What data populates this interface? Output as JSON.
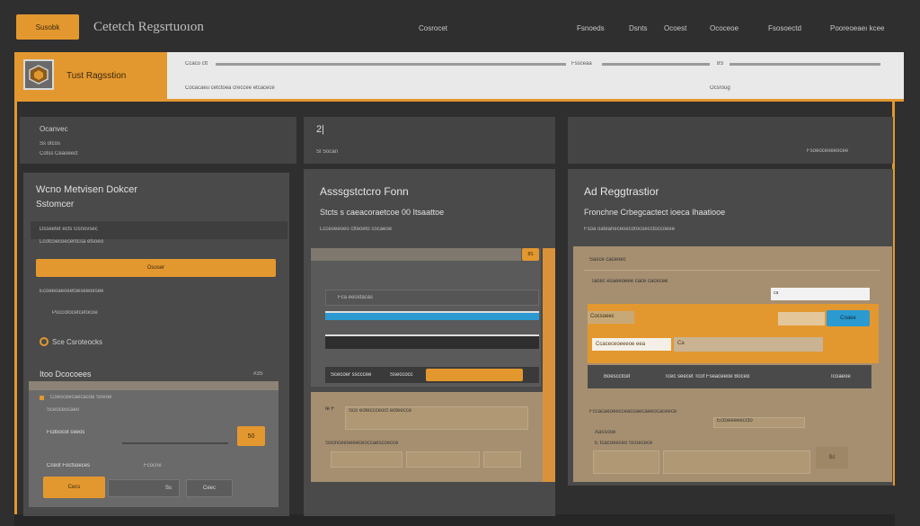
{
  "topbar": {
    "brand_button": "Susobk",
    "title": "Cetetch Regsrtuoıon",
    "nav": [
      "Cosrocet",
      "Fsnoeds",
      "Dsnts",
      "Ocoest",
      "Ococeoe",
      "Fsosoectd",
      "Pooreoeaeı kcee"
    ]
  },
  "header": {
    "title": "Tust Ragsstion",
    "field1_label": "Ccaco ctt",
    "field2_label": "Fssceaa",
    "field3_label": "8S",
    "subline": "Cocacaeu cetctoea creccee etcacece",
    "right_sub": "Ocsroug"
  },
  "left": {
    "tile_title": "Ocanvec",
    "tile_line1": "Ss otcos",
    "tile_line2": "Cotss Ceaoeect",
    "card_title": "Wcno Metvisen Dokcer",
    "card_sub": "Sstomcer",
    "line_a": "Dsseetet ects Gsnovsec",
    "line_b": "Lcotcoecoecentcsa etsoeo",
    "btn_label": "Ososer",
    "line_c": "Ecoeeoaeoeetoeseeoesee",
    "line_d": "Poccotocetcetocoe",
    "radio_label": "Sce Csroteocks",
    "section_title": "Itoo Dcocoees",
    "section_num": "#3S",
    "sub_a": "Coesceecaecacoe Soeoe",
    "sub_b": "Sceoceocaeo",
    "input_label": "Fcdoocot ceeos",
    "go_label": "50",
    "foot_a": "Cceot Focfsoeces",
    "foot_b": "Fcocne",
    "foot_btn": "Cecs",
    "foot_c": "Ss",
    "foot_d": "Ceec"
  },
  "middle": {
    "tile_num": "2|",
    "tile_sub": "Sl Socan",
    "card_title": "Asssgstctcro Fonn",
    "card_sub": "Stcts s caeacoraetcoe 00 Itsaattoe",
    "meta": "Lcceoeeoeo ctteoeto cocaeoe",
    "badge": "8S",
    "field_label": "Fca eecetacas",
    "submit_label": "Scecoer sscccee",
    "submit_b": "Sseccocc",
    "lower_a": "Ie F",
    "lower_b": "Sco eoteccceoct eoteecce",
    "lower_c": "Soonceeoeeeceoccaescoecce"
  },
  "right": {
    "tile_link": "Fsoeoceoeeocee",
    "card_title": "Ad Reggtrastior",
    "card_sub": "Fronchne Crbegcactect ioeca Ihaatiooe",
    "meta": "Fsoa oateaneceoecotocoecctoccoeee",
    "form_title": "Sasce caceoec",
    "form_label": "Tacec esaeeoeee cace cacecee",
    "input_val": "ca",
    "row_label": "Cocsoeec",
    "row_btn": "Coaee",
    "input2": "Ccaceceoeeeoe eea",
    "input3": "Ca",
    "dark_a": "Boescctcet",
    "dark_b": "Tcec seecet Tcof Fseaceeoe Boceɑ",
    "dark_c": "Tcoaeoe",
    "lower_a": "Fccacaeoeecceacoaecaeeocaceece",
    "lower_b": "Ectoeeeeeccto",
    "lower_c": "Aassooe",
    "lower_d": "E tcacoeeceo  Scoecece",
    "lower_btn": "Sc"
  },
  "colors": {
    "accent": "#e3982f",
    "blue": "#2b9ad0",
    "bg": "#2f2f2f"
  }
}
